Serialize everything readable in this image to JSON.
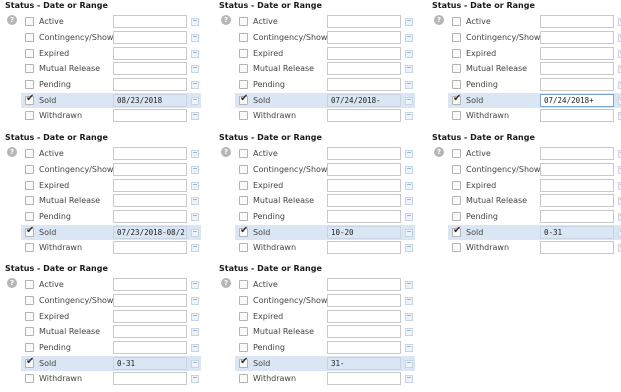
{
  "panels": [
    {
      "title": "Status - Date or Range",
      "help": "?",
      "selected_value": "08/23/2018"
    },
    {
      "title": "Status - Date or Range",
      "help": "?",
      "selected_value": "07/24/2018-"
    },
    {
      "title": "Status - Date or Range",
      "help": "?",
      "selected_value": "07/24/2018+"
    },
    {
      "title": "Status - Date or Range",
      "help": "?",
      "selected_value": "07/23/2018-08/2"
    },
    {
      "title": "Status - Date or Range",
      "help": "?",
      "selected_value": "10-20"
    },
    {
      "title": "Status - Date or Range",
      "help": "?",
      "selected_value": "0-31"
    },
    {
      "title": "Status - Date or Range",
      "help": "?",
      "selected_value": "0-31"
    },
    {
      "title": "Status - Date or Range",
      "help": "?",
      "selected_value": "31-"
    }
  ],
  "status_labels": [
    "Active",
    "Contingency/Show",
    "Expired",
    "Mutual Release",
    "Pending",
    "Sold",
    "Withdrawn"
  ],
  "checked_status": "Sold",
  "check_mark": "✔",
  "icons": {
    "help": "help-icon",
    "calendar": "calendar-icon"
  },
  "colors": {
    "selected_row": "#dbe6f4",
    "focused_border": "#7aa3d1"
  }
}
